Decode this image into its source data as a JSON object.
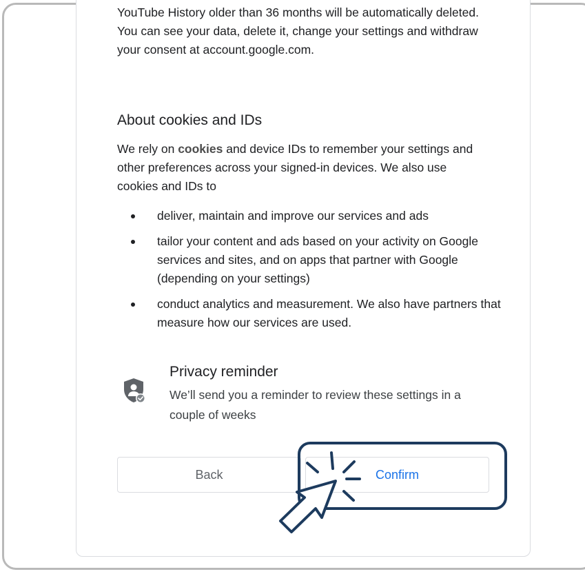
{
  "intro": {
    "text": "YouTube History older than 36 months will be automatically deleted. You can see your data, delete it, change your settings and withdraw your consent at account.google.com."
  },
  "cookies": {
    "heading": "About cookies and IDs",
    "before_link": "We rely on ",
    "link_text": "cookies",
    "after_link": " and device IDs to remember your settings and other preferences across your signed-in devices. We also use cookies and IDs to",
    "bullets": [
      "deliver, maintain and improve our services and ads",
      "tailor your content and ads based on your activity on Google services and sites, and on apps that partner with Google (depending on your settings)",
      "conduct analytics and measurement. We also have partners that measure how our services are used."
    ]
  },
  "reminder": {
    "icon": "privacy-shield-icon",
    "title": "Privacy reminder",
    "text": "We’ll send you a reminder to review these settings in a couple of weeks"
  },
  "actions": {
    "back_label": "Back",
    "confirm_label": "Confirm"
  },
  "annotation": {
    "highlight_target": "confirm-button",
    "cursor_icon": "click-pointer-icon",
    "highlight_color": "#1d3b5e"
  },
  "colors": {
    "confirm_text": "#1a73e8",
    "back_text": "#5f6368",
    "body_text": "#202124"
  }
}
